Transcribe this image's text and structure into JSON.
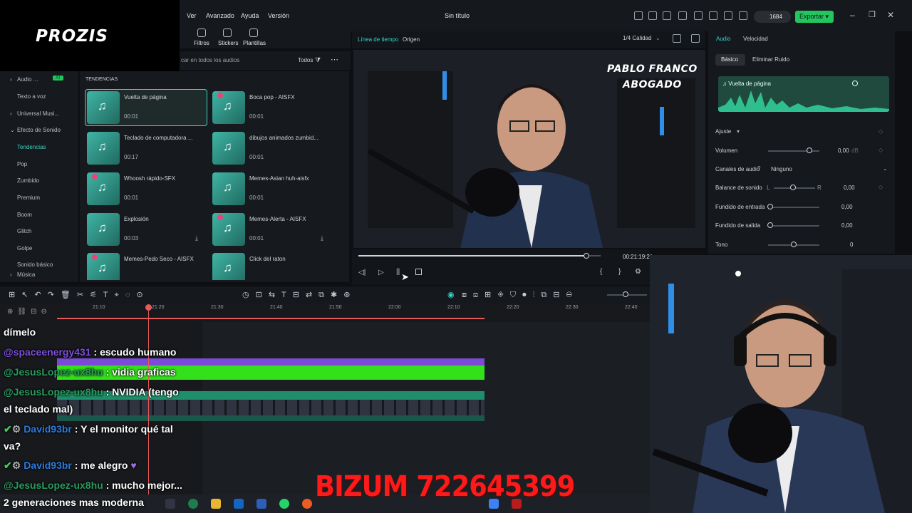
{
  "app": {
    "menu": [
      "Ver",
      "Avanzado",
      "Ayuda",
      "Versión"
    ],
    "project_title": "Sin título",
    "credits": "1684",
    "export_label": "Exportar",
    "brand": "PROZIS"
  },
  "tool_tabs": [
    "Filtros",
    "Stickers",
    "Plantillas"
  ],
  "search": {
    "placeholder": "car en todos los audios",
    "filter": "Todos"
  },
  "sidebar": {
    "items": [
      "Audio ...",
      "Texto a voz",
      "Universal Musi...",
      "Efecto de Sonido",
      "Tendencias",
      "Pop",
      "Zumbido",
      "Premium",
      "Boom",
      "Glitch",
      "Golpe",
      "Sonido básico",
      "Música"
    ],
    "ai_badge": "AI"
  },
  "library": {
    "section": "TENDENCIAS",
    "cards": [
      {
        "name": "Vuelta de página",
        "duration": "00:01"
      },
      {
        "name": "Boca pop - AISFX",
        "duration": "00:01"
      },
      {
        "name": "Teclado de computadora ...",
        "duration": "00:17"
      },
      {
        "name": "dibujos animados zumbid...",
        "duration": "00:01"
      },
      {
        "name": "Whoosh rápido-SFX",
        "duration": "00:01"
      },
      {
        "name": "Memes-Asian huh-aisfx",
        "duration": "00:01"
      },
      {
        "name": "Explosión",
        "duration": "00:03"
      },
      {
        "name": "Memes-Alerta - AISFX",
        "duration": "00:01"
      },
      {
        "name": "Memes-Pedo Seco - AISFX",
        "duration": "00:01"
      },
      {
        "name": "Click del raton",
        "duration": "00:01"
      }
    ]
  },
  "preview": {
    "tabs": [
      "Línea de tiempo",
      "Origen"
    ],
    "quality": "1/4 Calidad",
    "overlay_line1": "PABLO FRANCO",
    "overlay_line2": "ABOGADO",
    "timecode": "00:21:19:21",
    "progress": 0.94
  },
  "properties": {
    "tabs": [
      "Audio",
      "Velocidad"
    ],
    "subtabs": [
      "Básico",
      "Eliminar Ruido"
    ],
    "clip": "Vuelta de página",
    "section": "Ajuste",
    "rows": [
      {
        "label": "Volumen",
        "value": "0,00",
        "unit": "dB"
      },
      {
        "label": "Canales de audio",
        "value": "Ninguno"
      },
      {
        "label": "Balance de sonido",
        "value": "0,00"
      },
      {
        "label": "Fundido de entrada",
        "value": "0,00"
      },
      {
        "label": "Fundido de salida",
        "value": "0,00"
      },
      {
        "label": "Tono",
        "value": "0"
      }
    ],
    "balance_l": "L",
    "balance_r": "R"
  },
  "timeline": {
    "ticks": [
      "21:10",
      "21:20",
      "21:30",
      "21:40",
      "21:50",
      "22:00",
      "22:10",
      "22:20",
      "22:30",
      "22:40"
    ]
  },
  "chat": [
    {
      "user": "",
      "text": "dímelo"
    },
    {
      "user": "@spaceenergy431",
      "text": ": escudo humano"
    },
    {
      "user": "@JesusLopez-ux8hu",
      "text": ": vidia graficas"
    },
    {
      "user": "@JesusLopez-ux8hu",
      "text": ": NVIDIA (tengo"
    },
    {
      "user": "",
      "text": "el teclado mal)"
    },
    {
      "user": "David93br",
      "text": ": Y el monitor qué tal"
    },
    {
      "user": "",
      "text": "va?"
    },
    {
      "user": "David93br",
      "text": ": me alegro"
    },
    {
      "user": "@JesusLopez-ux8hu",
      "text": ": mucho mejor..."
    },
    {
      "user": "",
      "text": "2 generaciones mas moderna"
    }
  ],
  "bizum": "BIZUM 722645399",
  "colors": {
    "accent": "#35d6c8",
    "export": "#22c55e",
    "bizum": "#ff1a1a",
    "playhead": "#e85a5a"
  }
}
